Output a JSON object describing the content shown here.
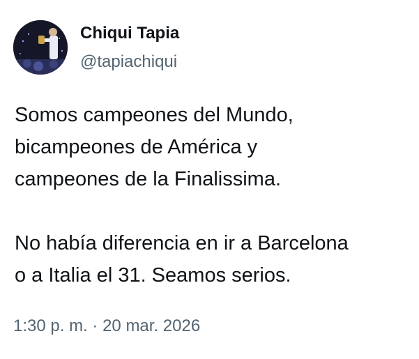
{
  "author": {
    "display_name": "Chiqui Tapia",
    "handle": "@tapiachiqui"
  },
  "tweet": {
    "paragraphs": [
      [
        "Somos campeones del Mundo,",
        "bicampeones de América y",
        "campeones de la Finalissima."
      ],
      [
        "No había diferencia en ir a Barcelona",
        "o a Italia el 31. Seamos serios."
      ]
    ],
    "time": "1:30 p. m.",
    "separator": "·",
    "date": "20 mar. 2026"
  },
  "colors": {
    "text": "#0f1419",
    "secondary": "#536471"
  }
}
